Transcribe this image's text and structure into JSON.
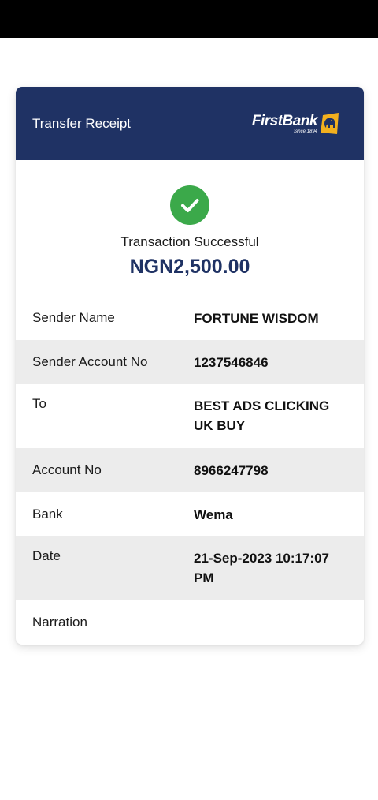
{
  "receipt": {
    "title": "Transfer Receipt",
    "logo": {
      "brand": "FirstBank",
      "since": "Since 1894",
      "icon": "elephant-logo-icon"
    },
    "status_text": "Transaction Successful",
    "amount": "NGN2,500.00",
    "status_icon": "check-icon",
    "details": [
      {
        "label": "Sender Name",
        "value": "FORTUNE WISDOM"
      },
      {
        "label": "Sender Account No",
        "value": "1237546846"
      },
      {
        "label": "To",
        "value": "BEST ADS CLICKING UK BUY"
      },
      {
        "label": "Account No",
        "value": "8966247798"
      },
      {
        "label": "Bank",
        "value": "Wema"
      },
      {
        "label": "Date",
        "value": "21-Sep-2023 10:17:07 PM"
      },
      {
        "label": "Narration",
        "value": ""
      }
    ]
  },
  "colors": {
    "header": "#1f3264",
    "success_green": "#3ba94a",
    "logo_gold": "#f2b01e",
    "row_shade": "#ececec"
  }
}
